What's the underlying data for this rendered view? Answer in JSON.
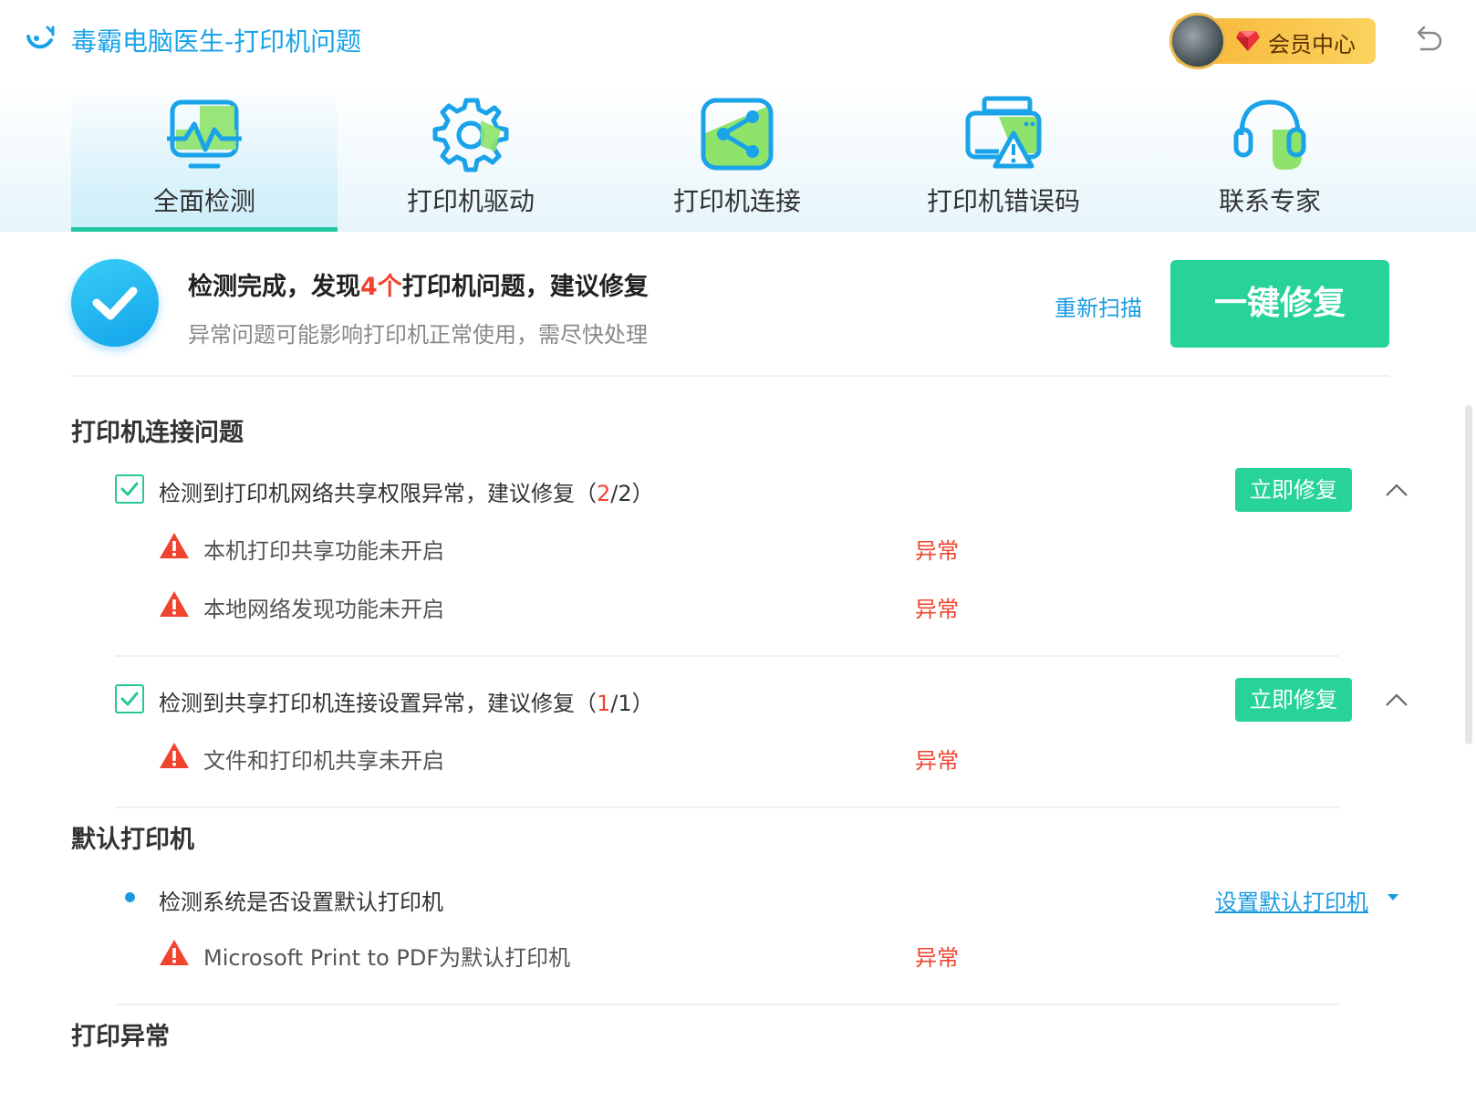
{
  "app": {
    "title": "毒霸电脑医生-打印机问题",
    "vip_label": "会员中心"
  },
  "tabs": [
    {
      "label": "全面检测",
      "icon": "monitor-pulse-icon",
      "active": true
    },
    {
      "label": "打印机驱动",
      "icon": "gear-icon",
      "active": false
    },
    {
      "label": "打印机连接",
      "icon": "share-icon",
      "active": false
    },
    {
      "label": "打印机错误码",
      "icon": "printer-warning-icon",
      "active": false
    },
    {
      "label": "联系专家",
      "icon": "headset-icon",
      "active": false
    }
  ],
  "summary": {
    "title_prefix": "检测完成，发现",
    "title_count": "4个",
    "title_suffix": "打印机问题，建议修复",
    "subtitle": "异常问题可能影响打印机正常使用，需尽快处理",
    "rescan_label": "重新扫描",
    "fix_all_label": "一键修复"
  },
  "sections": {
    "connection": {
      "title": "打印机连接问题",
      "groups": [
        {
          "label_prefix": "检测到打印机网络共享权限异常，建议修复（",
          "count_found": "2",
          "count_total": "/2）",
          "fix_label": "立即修复",
          "items": [
            {
              "label": "本机打印共享功能未开启",
              "status": "异常"
            },
            {
              "label": "本地网络发现功能未开启",
              "status": "异常"
            }
          ]
        },
        {
          "label_prefix": "检测到共享打印机连接设置异常，建议修复（",
          "count_found": "1",
          "count_total": "/1）",
          "fix_label": "立即修复",
          "items": [
            {
              "label": "文件和打印机共享未开启",
              "status": "异常"
            }
          ]
        }
      ]
    },
    "default_printer": {
      "title": "默认打印机",
      "check_label": "检测系统是否设置默认打印机",
      "action_label": "设置默认打印机",
      "items": [
        {
          "label": "Microsoft Print to PDF为默认打印机",
          "status": "异常"
        }
      ]
    },
    "print_errors": {
      "title": "打印异常"
    }
  },
  "colors": {
    "brand_blue": "#1a9be0",
    "accent_green": "#27d39b",
    "error_red": "#f0442f",
    "vip_gold": "#f7b637"
  }
}
